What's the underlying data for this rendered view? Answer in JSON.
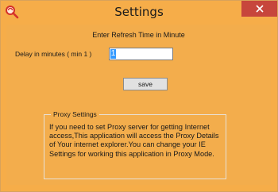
{
  "window": {
    "title": "Settings",
    "icon": "magnifier-key-icon",
    "close_icon": "close-icon",
    "colors": {
      "background": "#f6ad49",
      "close_button": "#c7463c"
    }
  },
  "form": {
    "heading": "Enter Refresh Time in Minute",
    "delay_label": "Delay in minutes ( min 1 )",
    "delay_value": "1",
    "save_label": "save"
  },
  "proxy": {
    "legend": "Proxy Settings",
    "text": "If you need to set Proxy server for getting Internet access,This application will access the Proxy Details of Your internet explorer.You can change your IE Settings for working this application in Proxy Mode."
  }
}
